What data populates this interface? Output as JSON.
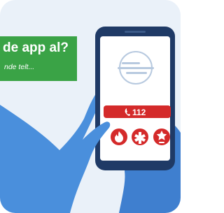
{
  "banner": {
    "title": "de app al?",
    "subtitle": "nde telt..."
  },
  "phone": {
    "call_label": "112",
    "call_icon": "phone-icon",
    "service_icons": [
      "fire-service-icon",
      "medical-service-icon",
      "police-service-icon"
    ]
  },
  "colors": {
    "background": "#eaf1f9",
    "banner_green": "#3aa346",
    "alert_red": "#d42a2a",
    "phone_navy": "#1f3a66",
    "hand_blue": "#4a8fdc"
  }
}
